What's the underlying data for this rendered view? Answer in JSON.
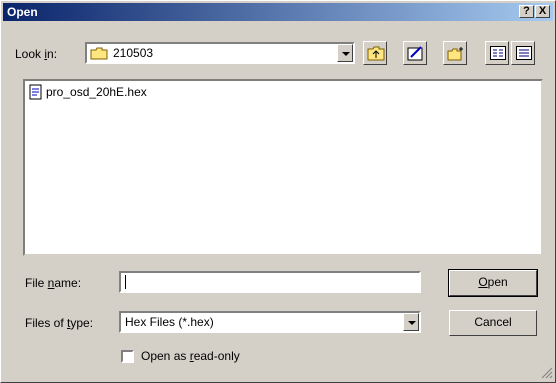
{
  "title": "Open",
  "title_buttons": {
    "help": "?",
    "close": "X"
  },
  "look_in": {
    "label_pre": "Look ",
    "label_u": "i",
    "label_post": "n:",
    "value": "210503"
  },
  "files": [
    {
      "name": "pro_osd_20hE.hex"
    }
  ],
  "file_name": {
    "label_pre": "File ",
    "label_u": "n",
    "label_post": "ame:",
    "value": ""
  },
  "files_of_type": {
    "label_pre": "Files of ",
    "label_u": "t",
    "label_post": "ype:",
    "value": "Hex Files (*.hex)"
  },
  "read_only": {
    "label_pre": "Open as ",
    "label_u": "r",
    "label_post": "ead-only"
  },
  "buttons": {
    "open_u": "O",
    "open_rest": "pen",
    "cancel": "Cancel"
  }
}
